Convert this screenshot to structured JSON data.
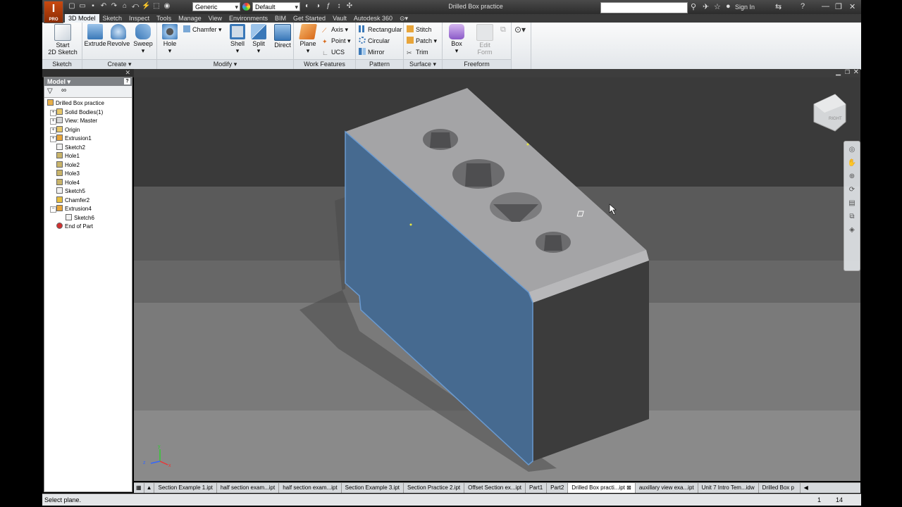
{
  "app": {
    "logo_letter": "I",
    "logo_sub": "PRO",
    "document_title": "Drilled Box practice",
    "sign_in": "Sign In"
  },
  "qat": {
    "material": "Generic",
    "appearance": "Default"
  },
  "ribbon_tabs": [
    "3D Model",
    "Sketch",
    "Inspect",
    "Tools",
    "Manage",
    "View",
    "Environments",
    "BIM",
    "Get Started",
    "Vault",
    "Autodesk 360"
  ],
  "active_tab": "3D Model",
  "ribbon": {
    "sketch": {
      "label": "Sketch",
      "start_line1": "Start",
      "start_line2": "2D Sketch"
    },
    "create": {
      "label": "Create ▾",
      "extrude": "Extrude",
      "revolve": "Revolve",
      "sweep": "Sweep"
    },
    "modify": {
      "label": "Modify ▾",
      "hole": "Hole",
      "chamfer": "Chamfer",
      "shell": "Shell",
      "split": "Split",
      "direct": "Direct"
    },
    "work_features": {
      "label": "Work Features",
      "plane": "Plane",
      "axis": "Axis",
      "point": "Point",
      "ucs": "UCS"
    },
    "pattern": {
      "label": "Pattern",
      "rectangular": "Rectangular",
      "circular": "Circular",
      "mirror": "Mirror"
    },
    "surface": {
      "label": "Surface ▾",
      "stitch": "Stitch",
      "patch": "Patch",
      "trim": "Trim"
    },
    "freeform": {
      "label": "Freeform",
      "box": "Box",
      "edit_form_line1": "Edit",
      "edit_form_line2": "Form"
    }
  },
  "browser": {
    "title": "Model ▾",
    "items": [
      {
        "label": "Drilled Box practice",
        "indent": 0,
        "icon": "part-icon",
        "color": "#e8b04a"
      },
      {
        "label": "Solid Bodies(1)",
        "indent": 1,
        "icon": "folder-icon",
        "color": "#e8c86a"
      },
      {
        "label": "View: Master",
        "indent": 1,
        "icon": "view-icon",
        "color": "#d8d8d8"
      },
      {
        "label": "Origin",
        "indent": 1,
        "icon": "folder-icon",
        "color": "#e8c86a"
      },
      {
        "label": "Extrusion1",
        "indent": 1,
        "icon": "extrusion-icon",
        "color": "#e8a53a"
      },
      {
        "label": "Sketch2",
        "indent": 1,
        "icon": "sketch-icon",
        "color": "#f2f2f2"
      },
      {
        "label": "Hole1",
        "indent": 1,
        "icon": "hole-icon",
        "color": "#c9b46a"
      },
      {
        "label": "Hole2",
        "indent": 1,
        "icon": "hole-icon",
        "color": "#c9b46a"
      },
      {
        "label": "Hole3",
        "indent": 1,
        "icon": "hole-icon",
        "color": "#c9b46a"
      },
      {
        "label": "Hole4",
        "indent": 1,
        "icon": "hole-icon",
        "color": "#c9b46a"
      },
      {
        "label": "Sketch5",
        "indent": 1,
        "icon": "sketch-icon",
        "color": "#f2f2f2"
      },
      {
        "label": "Chamfer2",
        "indent": 1,
        "icon": "chamfer-icon",
        "color": "#e8c040"
      },
      {
        "label": "Extrusion4",
        "indent": 1,
        "icon": "extrusion-icon",
        "color": "#e8a53a"
      },
      {
        "label": "Sketch6",
        "indent": 2,
        "icon": "sketch-icon",
        "color": "#f2f2f2"
      },
      {
        "label": "End of Part",
        "indent": 1,
        "icon": "end-of-part-icon",
        "color": "#d03030"
      }
    ]
  },
  "doc_tabs": [
    "Section Example 1.ipt",
    "half section exam...ipt",
    "half section exam...ipt",
    "Section Example 3.ipt",
    "Section Practice 2.ipt",
    "Offset Section ex...ipt",
    "Part1",
    "Part2",
    "Drilled Box practi...ipt",
    "auxillary view exa...ipt",
    "Unit 7 Intro Tem...idw",
    "Drilled Box p"
  ],
  "active_doc_tab": 8,
  "status": {
    "message": "Select plane.",
    "count_a": "1",
    "count_b": "14"
  },
  "viewcube": {
    "face_label": "RIGHT"
  },
  "colors": {
    "selected_face": "#466a90",
    "top_face": "#a4a4a6",
    "side_face": "#3c3c3c",
    "accent": "#c94a10"
  }
}
